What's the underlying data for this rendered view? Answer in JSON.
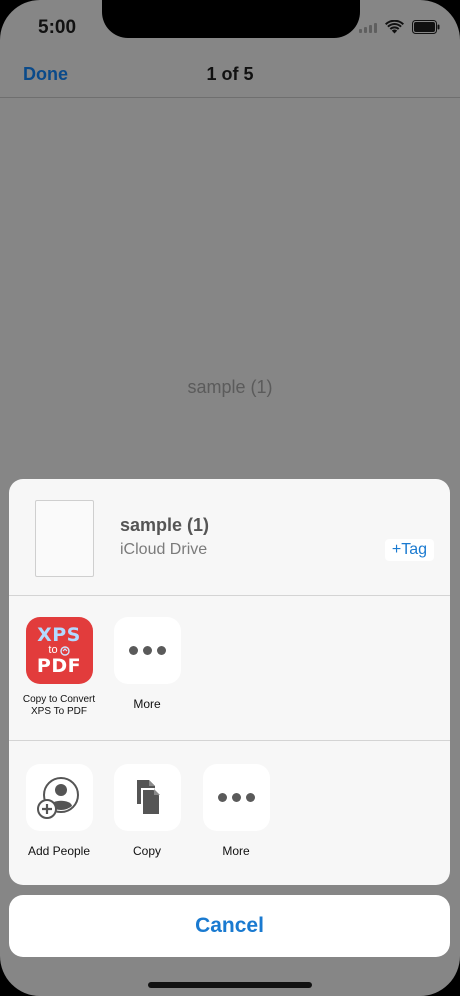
{
  "status_bar": {
    "time": "5:00"
  },
  "nav": {
    "done_label": "Done",
    "title": "1 of 5"
  },
  "document": {
    "placeholder_text": "sample (1)"
  },
  "share_sheet": {
    "file_name": "sample (1)",
    "file_location": "iCloud Drive",
    "tag_label": "+Tag",
    "apps": [
      {
        "label": "Copy to Convert XPS To PDF",
        "icon": "xps-to-pdf-app-icon",
        "icon_text_top": "XPS",
        "icon_text_mid": "to",
        "icon_text_bottom": "PDF"
      },
      {
        "label": "More",
        "icon": "more-icon"
      }
    ],
    "actions": [
      {
        "label": "Add People",
        "icon": "add-people-icon"
      },
      {
        "label": "Copy",
        "icon": "copy-icon"
      },
      {
        "label": "More",
        "icon": "more-icon"
      }
    ]
  },
  "cancel_label": "Cancel",
  "colors": {
    "accent": "#1a7ad0",
    "app_icon_red": "#e23c3c",
    "dim_background": "#868686"
  }
}
